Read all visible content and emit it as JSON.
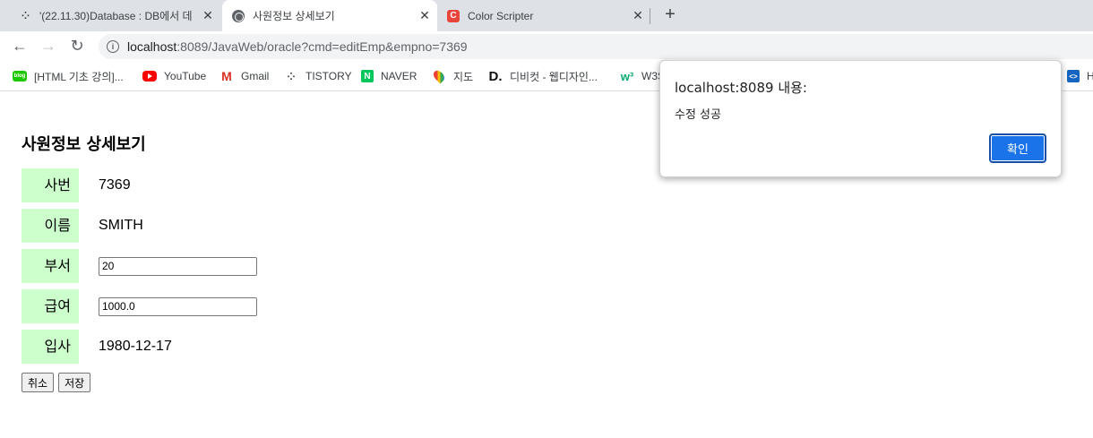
{
  "tabs": [
    {
      "title": "'(22.11.30)Database : DB에서 데",
      "favicon": "dots-icon",
      "active": false
    },
    {
      "title": "사원정보 상세보기",
      "favicon": "globe-icon",
      "active": true
    },
    {
      "title": "Color Scripter",
      "favicon": "color-scripter-icon",
      "active": false
    }
  ],
  "toolbar": {
    "url_host": "localhost",
    "url_rest": ":8089/JavaWeb/oracle?cmd=editEmp&empno=7369"
  },
  "bookmarks": [
    {
      "label": "[HTML 기초 강의]...",
      "icon": "blog-icon"
    },
    {
      "label": "YouTube",
      "icon": "youtube-icon"
    },
    {
      "label": "Gmail",
      "icon": "gmail-icon"
    },
    {
      "label": "TISTORY",
      "icon": "tistory-icon"
    },
    {
      "label": "NAVER",
      "icon": "naver-icon"
    },
    {
      "label": "지도",
      "icon": "maps-icon"
    },
    {
      "label": "디비컷 - 웹디자인...",
      "icon": "dbcut-icon"
    },
    {
      "label": "W3S",
      "icon": "w3schools-icon"
    },
    {
      "label": "H",
      "icon": "code-icon"
    }
  ],
  "page": {
    "title": "사원정보 상세보기",
    "fields": {
      "empno_label": "사번",
      "empno_value": "7369",
      "ename_label": "이름",
      "ename_value": "SMITH",
      "dept_label": "부서",
      "dept_value": "20",
      "sal_label": "급여",
      "sal_value": "1000.0",
      "hire_label": "입사",
      "hire_value": "1980-12-17"
    },
    "cancel_label": "취소",
    "save_label": "저장"
  },
  "dialog": {
    "title": "localhost:8089 내용:",
    "message": "수정 성공",
    "ok_label": "확인"
  },
  "colors": {
    "label_bg": "#ccffcc",
    "dialog_ok": "#1a73e8",
    "tabstrip_bg": "#dee1e6"
  }
}
